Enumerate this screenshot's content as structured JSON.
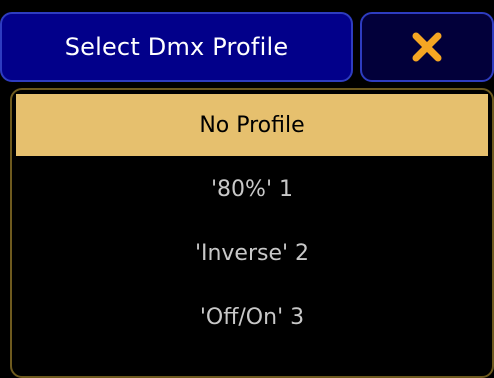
{
  "dialog": {
    "title": "Select Dmx Profile",
    "close_icon": "close-icon",
    "accent_color": "#f5a623",
    "title_bg_color": "#02008a",
    "selected_bg_color": "#e6c06e"
  },
  "profiles": {
    "items": [
      {
        "label": "No Profile",
        "selected": true
      },
      {
        "label": "'80%' 1",
        "selected": false
      },
      {
        "label": "'Inverse' 2",
        "selected": false
      },
      {
        "label": "'Off/On' 3",
        "selected": false
      }
    ]
  }
}
